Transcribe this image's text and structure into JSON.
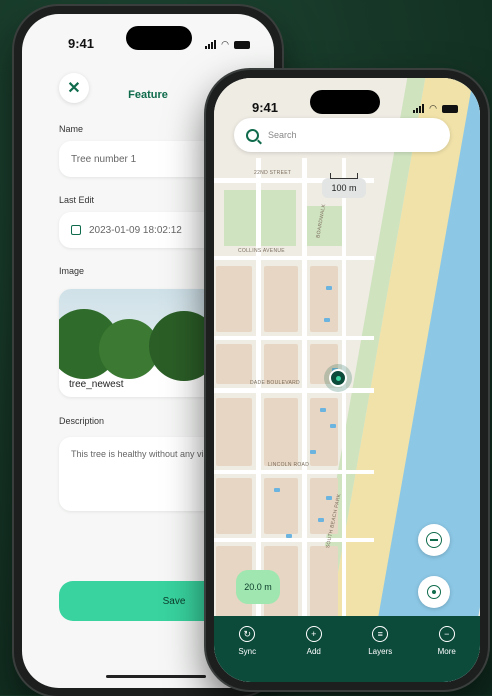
{
  "feature_screen": {
    "status_time": "9:41",
    "title": "Feature",
    "close_icon": "close-icon",
    "name_label": "Name",
    "name_value": "Tree number 1",
    "last_edit_label": "Last Edit",
    "last_edit_value": "2023-01-09 18:02:12",
    "image_label": "Image",
    "image_name": "tree_newest",
    "description_label": "Description",
    "description_value": "This tree is healthy without any visu",
    "save_label": "Save"
  },
  "map_screen": {
    "status_time": "9:41",
    "search_placeholder": "Search",
    "scale_label": "100 m",
    "accuracy_label": "20.0 m",
    "street_labels": [
      "22ND STREET",
      "COLLINS AVENUE",
      "DADE BOULEVARD",
      "BOARDWALK",
      "LINCOLN ROAD",
      "SOUTH BEACH PARK"
    ],
    "nav": [
      {
        "label": "Sync",
        "icon": "sync-icon"
      },
      {
        "label": "Add",
        "icon": "add-icon"
      },
      {
        "label": "Layers",
        "icon": "layers-icon"
      },
      {
        "label": "More",
        "icon": "more-icon"
      }
    ]
  },
  "colors": {
    "brand_dark": "#0c4a3a",
    "accent_green": "#38d39f",
    "sea": "#8cc8e6",
    "beach": "#f0e2a8"
  }
}
